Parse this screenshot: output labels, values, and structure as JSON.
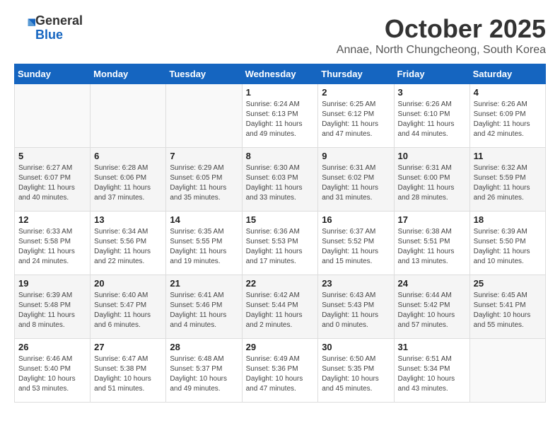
{
  "logo": {
    "general": "General",
    "blue": "Blue"
  },
  "title": "October 2025",
  "subtitle": "Annae, North Chungcheong, South Korea",
  "days_of_week": [
    "Sunday",
    "Monday",
    "Tuesday",
    "Wednesday",
    "Thursday",
    "Friday",
    "Saturday"
  ],
  "weeks": [
    [
      {
        "day": "",
        "info": ""
      },
      {
        "day": "",
        "info": ""
      },
      {
        "day": "",
        "info": ""
      },
      {
        "day": "1",
        "info": "Sunrise: 6:24 AM\nSunset: 6:13 PM\nDaylight: 11 hours\nand 49 minutes."
      },
      {
        "day": "2",
        "info": "Sunrise: 6:25 AM\nSunset: 6:12 PM\nDaylight: 11 hours\nand 47 minutes."
      },
      {
        "day": "3",
        "info": "Sunrise: 6:26 AM\nSunset: 6:10 PM\nDaylight: 11 hours\nand 44 minutes."
      },
      {
        "day": "4",
        "info": "Sunrise: 6:26 AM\nSunset: 6:09 PM\nDaylight: 11 hours\nand 42 minutes."
      }
    ],
    [
      {
        "day": "5",
        "info": "Sunrise: 6:27 AM\nSunset: 6:07 PM\nDaylight: 11 hours\nand 40 minutes."
      },
      {
        "day": "6",
        "info": "Sunrise: 6:28 AM\nSunset: 6:06 PM\nDaylight: 11 hours\nand 37 minutes."
      },
      {
        "day": "7",
        "info": "Sunrise: 6:29 AM\nSunset: 6:05 PM\nDaylight: 11 hours\nand 35 minutes."
      },
      {
        "day": "8",
        "info": "Sunrise: 6:30 AM\nSunset: 6:03 PM\nDaylight: 11 hours\nand 33 minutes."
      },
      {
        "day": "9",
        "info": "Sunrise: 6:31 AM\nSunset: 6:02 PM\nDaylight: 11 hours\nand 31 minutes."
      },
      {
        "day": "10",
        "info": "Sunrise: 6:31 AM\nSunset: 6:00 PM\nDaylight: 11 hours\nand 28 minutes."
      },
      {
        "day": "11",
        "info": "Sunrise: 6:32 AM\nSunset: 5:59 PM\nDaylight: 11 hours\nand 26 minutes."
      }
    ],
    [
      {
        "day": "12",
        "info": "Sunrise: 6:33 AM\nSunset: 5:58 PM\nDaylight: 11 hours\nand 24 minutes."
      },
      {
        "day": "13",
        "info": "Sunrise: 6:34 AM\nSunset: 5:56 PM\nDaylight: 11 hours\nand 22 minutes."
      },
      {
        "day": "14",
        "info": "Sunrise: 6:35 AM\nSunset: 5:55 PM\nDaylight: 11 hours\nand 19 minutes."
      },
      {
        "day": "15",
        "info": "Sunrise: 6:36 AM\nSunset: 5:53 PM\nDaylight: 11 hours\nand 17 minutes."
      },
      {
        "day": "16",
        "info": "Sunrise: 6:37 AM\nSunset: 5:52 PM\nDaylight: 11 hours\nand 15 minutes."
      },
      {
        "day": "17",
        "info": "Sunrise: 6:38 AM\nSunset: 5:51 PM\nDaylight: 11 hours\nand 13 minutes."
      },
      {
        "day": "18",
        "info": "Sunrise: 6:39 AM\nSunset: 5:50 PM\nDaylight: 11 hours\nand 10 minutes."
      }
    ],
    [
      {
        "day": "19",
        "info": "Sunrise: 6:39 AM\nSunset: 5:48 PM\nDaylight: 11 hours\nand 8 minutes."
      },
      {
        "day": "20",
        "info": "Sunrise: 6:40 AM\nSunset: 5:47 PM\nDaylight: 11 hours\nand 6 minutes."
      },
      {
        "day": "21",
        "info": "Sunrise: 6:41 AM\nSunset: 5:46 PM\nDaylight: 11 hours\nand 4 minutes."
      },
      {
        "day": "22",
        "info": "Sunrise: 6:42 AM\nSunset: 5:44 PM\nDaylight: 11 hours\nand 2 minutes."
      },
      {
        "day": "23",
        "info": "Sunrise: 6:43 AM\nSunset: 5:43 PM\nDaylight: 11 hours\nand 0 minutes."
      },
      {
        "day": "24",
        "info": "Sunrise: 6:44 AM\nSunset: 5:42 PM\nDaylight: 10 hours\nand 57 minutes."
      },
      {
        "day": "25",
        "info": "Sunrise: 6:45 AM\nSunset: 5:41 PM\nDaylight: 10 hours\nand 55 minutes."
      }
    ],
    [
      {
        "day": "26",
        "info": "Sunrise: 6:46 AM\nSunset: 5:40 PM\nDaylight: 10 hours\nand 53 minutes."
      },
      {
        "day": "27",
        "info": "Sunrise: 6:47 AM\nSunset: 5:38 PM\nDaylight: 10 hours\nand 51 minutes."
      },
      {
        "day": "28",
        "info": "Sunrise: 6:48 AM\nSunset: 5:37 PM\nDaylight: 10 hours\nand 49 minutes."
      },
      {
        "day": "29",
        "info": "Sunrise: 6:49 AM\nSunset: 5:36 PM\nDaylight: 10 hours\nand 47 minutes."
      },
      {
        "day": "30",
        "info": "Sunrise: 6:50 AM\nSunset: 5:35 PM\nDaylight: 10 hours\nand 45 minutes."
      },
      {
        "day": "31",
        "info": "Sunrise: 6:51 AM\nSunset: 5:34 PM\nDaylight: 10 hours\nand 43 minutes."
      },
      {
        "day": "",
        "info": ""
      }
    ]
  ]
}
